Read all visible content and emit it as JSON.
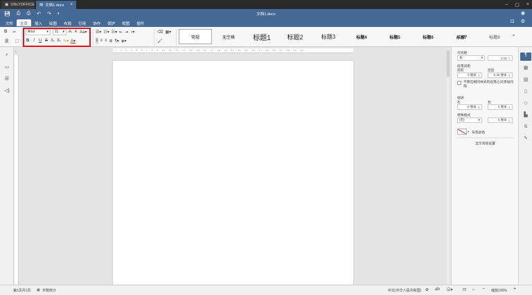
{
  "app": {
    "app_tab": "ONLYOFFICE",
    "doc_tab": "文档1.docx",
    "title": "文档1.docx"
  },
  "menu": {
    "tabs": [
      "文件",
      "主页",
      "插入",
      "绘图",
      "布局",
      "引用",
      "协作",
      "保护",
      "视图",
      "插件"
    ],
    "active": "主页"
  },
  "ribbon": {
    "font_name": "Arial",
    "font_size": "11",
    "styles": [
      "常规",
      "无空格",
      "标题1",
      "标题2",
      "标题3",
      "标题4",
      "标题5",
      "标题6",
      "标题7",
      "标题8"
    ],
    "selected_style": "常规"
  },
  "right_panel": {
    "line_spacing_label": "行间距",
    "line_spacing_type": "多",
    "line_spacing_value": "1.15",
    "paragraph_spacing_label": "段落间距",
    "before_label": "前前",
    "after_label": "后后",
    "before_value": "0 厘米",
    "after_value": "0.35 厘米",
    "no_space_label": "不要在相同样式的段落之间添加间",
    "no_space_label2": "隔",
    "indent_label": "缩进",
    "indent_left_label": "左",
    "indent_right_label": "右",
    "indent_left": "0 厘米",
    "indent_right": "0 厘米",
    "special_label": "特殊格式",
    "special_value": "(无)",
    "special_amount": "0 厘米",
    "bg_color_label": "背景颜色",
    "advanced_link": "显示高级设置"
  },
  "status": {
    "page": "第1页共1页",
    "word_count": "字数统计",
    "language": "中文(中华人民共和国)",
    "zoom": "缩放100%"
  },
  "colors": {
    "brand": "#446995",
    "highlight": "#e0141b"
  }
}
